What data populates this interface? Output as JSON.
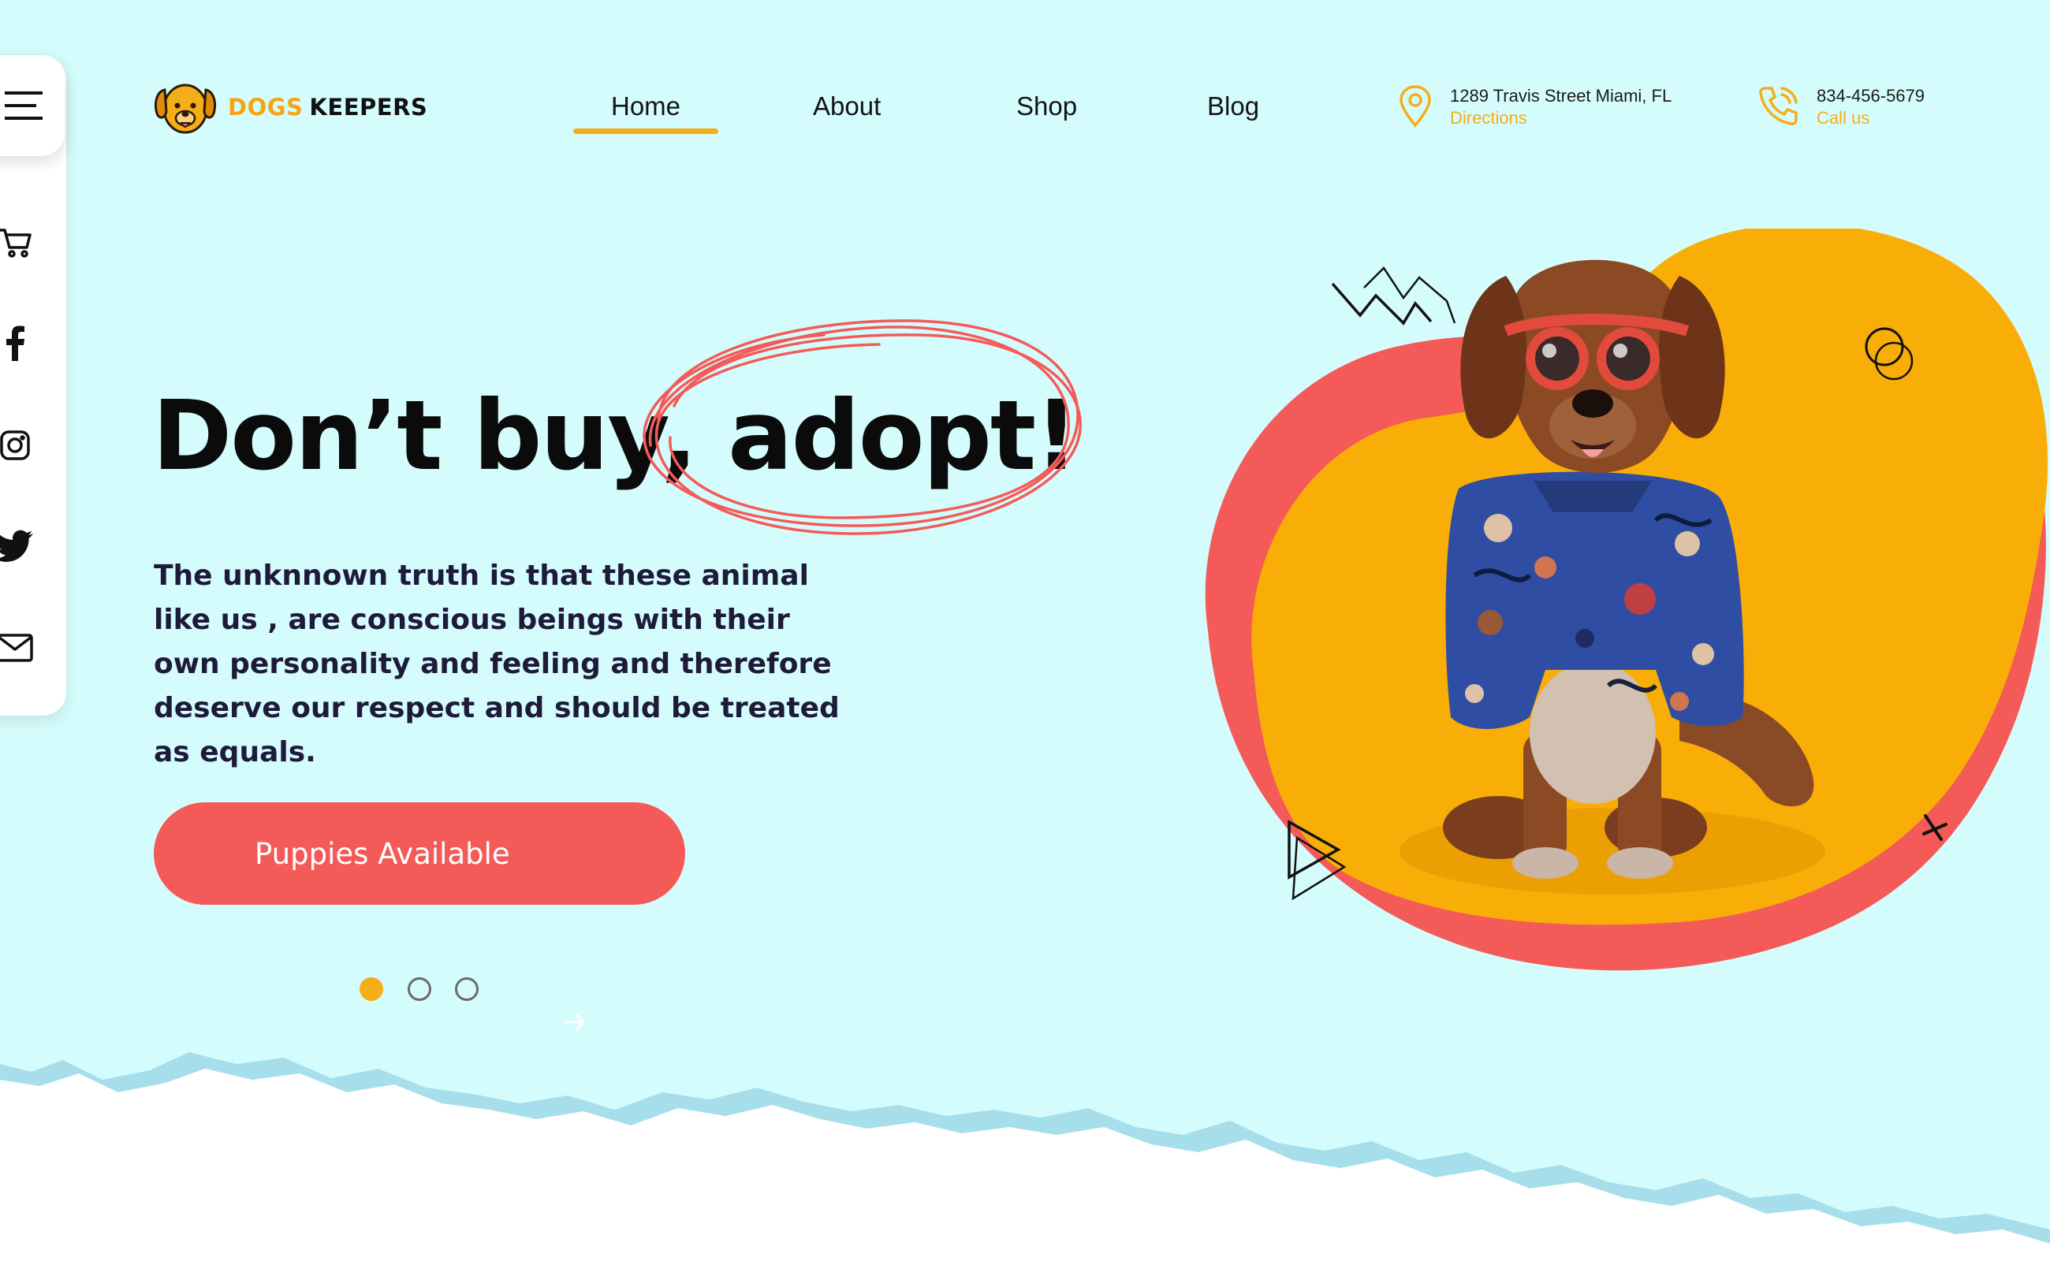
{
  "brand": {
    "name_accent": "DOGS",
    "name_rest": "KEEPERS",
    "logo_icon": "dog-face-icon"
  },
  "nav": {
    "items": [
      {
        "label": "Home",
        "active": true
      },
      {
        "label": "About",
        "active": false
      },
      {
        "label": "Shop",
        "active": false
      },
      {
        "label": "Blog",
        "active": false
      }
    ]
  },
  "contact": {
    "address": "1289 Travis Street Miami, FL",
    "address_link": "Directions",
    "phone": "834-456-5679",
    "phone_link": "Call us"
  },
  "sidebar": {
    "icons": [
      "menu-icon",
      "cart-icon",
      "facebook-icon",
      "instagram-icon",
      "twitter-icon",
      "mail-icon"
    ]
  },
  "hero": {
    "headline": "Don’t buy, adopt!",
    "body": "The unknnown truth is that these animal like us , are conscious beings with their own personality and feeling and therefore deserve our respect and should be treated as equals.",
    "cta_label": "Puppies Available",
    "slides": {
      "count": 3,
      "active_index": 0
    }
  },
  "colors": {
    "background": "#d5fcfc",
    "accent_orange": "#f6ad1a",
    "accent_red": "#f45a58",
    "text_dark": "#1e1b3a"
  }
}
